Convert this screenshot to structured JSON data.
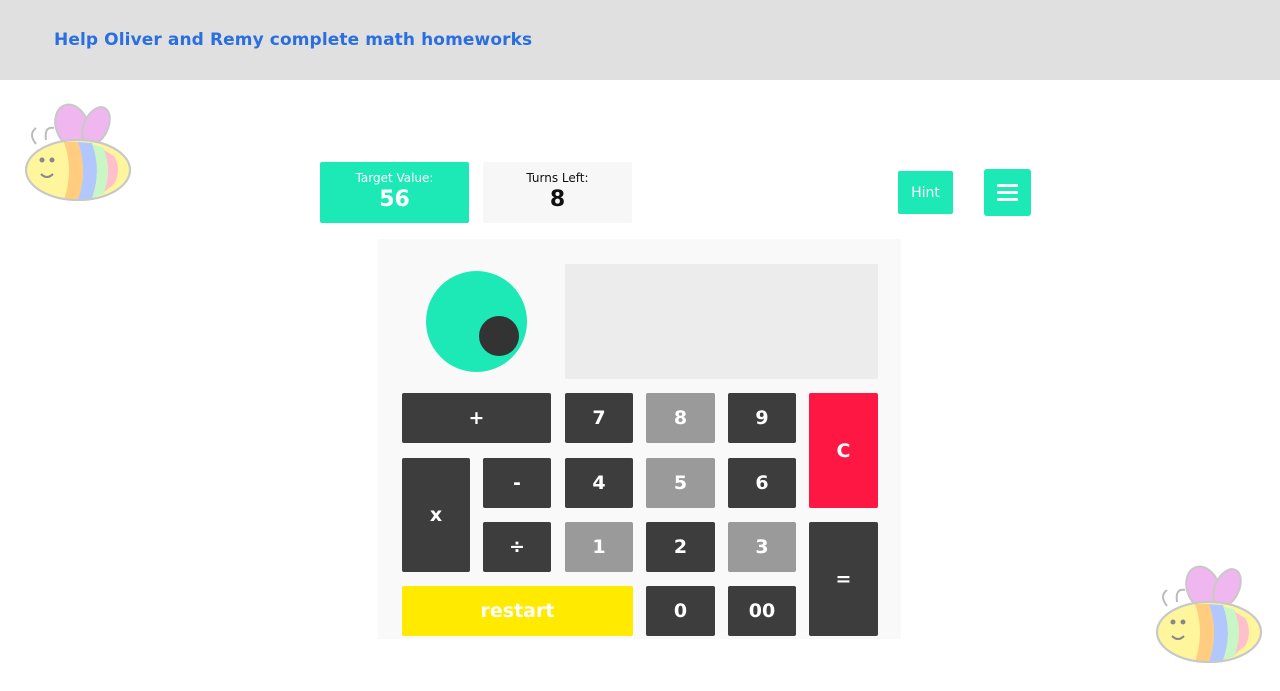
{
  "header": {
    "title": "Help Oliver and Remy complete math homeworks"
  },
  "stats": {
    "target_label": "Target Value:",
    "target_value": "56",
    "turns_label": "Turns Left:",
    "turns_value": "8"
  },
  "controls": {
    "hint_label": "Hint"
  },
  "display": {
    "value": ""
  },
  "keys": {
    "plus": "+",
    "times": "x",
    "minus": "-",
    "divide": "÷",
    "k7": "7",
    "k8": "8",
    "k9": "9",
    "k4": "4",
    "k5": "5",
    "k6": "6",
    "k1": "1",
    "k2": "2",
    "k3": "3",
    "k0": "0",
    "k00": "00",
    "clear": "C",
    "equals": "=",
    "restart": "restart"
  },
  "colors": {
    "accent": "#1de9b6",
    "title": "#2a6fe0",
    "key_dark": "#3d3d3d",
    "key_disabled": "#9a9a9a",
    "clear": "#ff1744",
    "restart": "#ffea00"
  }
}
